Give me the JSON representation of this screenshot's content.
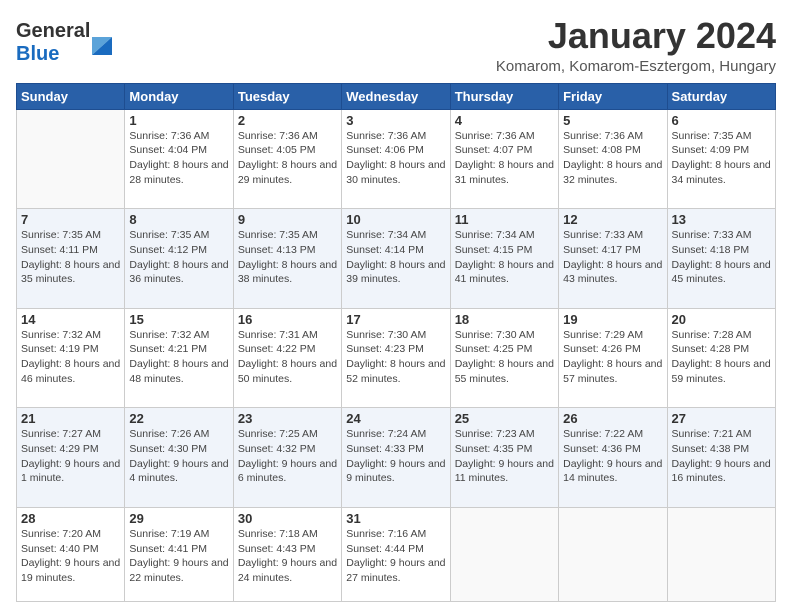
{
  "logo": {
    "general": "General",
    "blue": "Blue"
  },
  "title": "January 2024",
  "location": "Komarom, Komarom-Esztergom, Hungary",
  "days_of_week": [
    "Sunday",
    "Monday",
    "Tuesday",
    "Wednesday",
    "Thursday",
    "Friday",
    "Saturday"
  ],
  "weeks": [
    [
      {
        "day": null
      },
      {
        "day": "1",
        "sunrise": "7:36 AM",
        "sunset": "4:04 PM",
        "daylight": "8 hours and 28 minutes."
      },
      {
        "day": "2",
        "sunrise": "7:36 AM",
        "sunset": "4:05 PM",
        "daylight": "8 hours and 29 minutes."
      },
      {
        "day": "3",
        "sunrise": "7:36 AM",
        "sunset": "4:06 PM",
        "daylight": "8 hours and 30 minutes."
      },
      {
        "day": "4",
        "sunrise": "7:36 AM",
        "sunset": "4:07 PM",
        "daylight": "8 hours and 31 minutes."
      },
      {
        "day": "5",
        "sunrise": "7:36 AM",
        "sunset": "4:08 PM",
        "daylight": "8 hours and 32 minutes."
      },
      {
        "day": "6",
        "sunrise": "7:35 AM",
        "sunset": "4:09 PM",
        "daylight": "8 hours and 34 minutes."
      }
    ],
    [
      {
        "day": "7",
        "sunrise": "7:35 AM",
        "sunset": "4:11 PM",
        "daylight": "8 hours and 35 minutes."
      },
      {
        "day": "8",
        "sunrise": "7:35 AM",
        "sunset": "4:12 PM",
        "daylight": "8 hours and 36 minutes."
      },
      {
        "day": "9",
        "sunrise": "7:35 AM",
        "sunset": "4:13 PM",
        "daylight": "8 hours and 38 minutes."
      },
      {
        "day": "10",
        "sunrise": "7:34 AM",
        "sunset": "4:14 PM",
        "daylight": "8 hours and 39 minutes."
      },
      {
        "day": "11",
        "sunrise": "7:34 AM",
        "sunset": "4:15 PM",
        "daylight": "8 hours and 41 minutes."
      },
      {
        "day": "12",
        "sunrise": "7:33 AM",
        "sunset": "4:17 PM",
        "daylight": "8 hours and 43 minutes."
      },
      {
        "day": "13",
        "sunrise": "7:33 AM",
        "sunset": "4:18 PM",
        "daylight": "8 hours and 45 minutes."
      }
    ],
    [
      {
        "day": "14",
        "sunrise": "7:32 AM",
        "sunset": "4:19 PM",
        "daylight": "8 hours and 46 minutes."
      },
      {
        "day": "15",
        "sunrise": "7:32 AM",
        "sunset": "4:21 PM",
        "daylight": "8 hours and 48 minutes."
      },
      {
        "day": "16",
        "sunrise": "7:31 AM",
        "sunset": "4:22 PM",
        "daylight": "8 hours and 50 minutes."
      },
      {
        "day": "17",
        "sunrise": "7:30 AM",
        "sunset": "4:23 PM",
        "daylight": "8 hours and 52 minutes."
      },
      {
        "day": "18",
        "sunrise": "7:30 AM",
        "sunset": "4:25 PM",
        "daylight": "8 hours and 55 minutes."
      },
      {
        "day": "19",
        "sunrise": "7:29 AM",
        "sunset": "4:26 PM",
        "daylight": "8 hours and 57 minutes."
      },
      {
        "day": "20",
        "sunrise": "7:28 AM",
        "sunset": "4:28 PM",
        "daylight": "8 hours and 59 minutes."
      }
    ],
    [
      {
        "day": "21",
        "sunrise": "7:27 AM",
        "sunset": "4:29 PM",
        "daylight": "9 hours and 1 minute."
      },
      {
        "day": "22",
        "sunrise": "7:26 AM",
        "sunset": "4:30 PM",
        "daylight": "9 hours and 4 minutes."
      },
      {
        "day": "23",
        "sunrise": "7:25 AM",
        "sunset": "4:32 PM",
        "daylight": "9 hours and 6 minutes."
      },
      {
        "day": "24",
        "sunrise": "7:24 AM",
        "sunset": "4:33 PM",
        "daylight": "9 hours and 9 minutes."
      },
      {
        "day": "25",
        "sunrise": "7:23 AM",
        "sunset": "4:35 PM",
        "daylight": "9 hours and 11 minutes."
      },
      {
        "day": "26",
        "sunrise": "7:22 AM",
        "sunset": "4:36 PM",
        "daylight": "9 hours and 14 minutes."
      },
      {
        "day": "27",
        "sunrise": "7:21 AM",
        "sunset": "4:38 PM",
        "daylight": "9 hours and 16 minutes."
      }
    ],
    [
      {
        "day": "28",
        "sunrise": "7:20 AM",
        "sunset": "4:40 PM",
        "daylight": "9 hours and 19 minutes."
      },
      {
        "day": "29",
        "sunrise": "7:19 AM",
        "sunset": "4:41 PM",
        "daylight": "9 hours and 22 minutes."
      },
      {
        "day": "30",
        "sunrise": "7:18 AM",
        "sunset": "4:43 PM",
        "daylight": "9 hours and 24 minutes."
      },
      {
        "day": "31",
        "sunrise": "7:16 AM",
        "sunset": "4:44 PM",
        "daylight": "9 hours and 27 minutes."
      },
      {
        "day": null
      },
      {
        "day": null
      },
      {
        "day": null
      }
    ]
  ],
  "labels": {
    "sunrise": "Sunrise:",
    "sunset": "Sunset:",
    "daylight": "Daylight:"
  }
}
